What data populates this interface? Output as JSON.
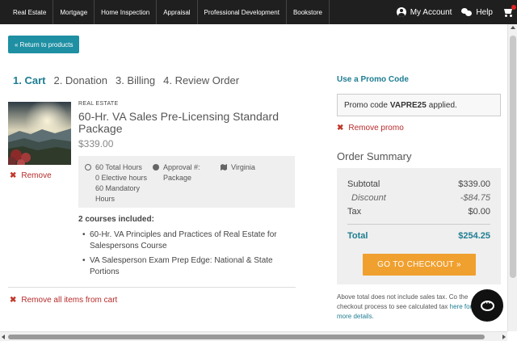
{
  "nav": {
    "items": [
      "Real Estate",
      "Mortgage",
      "Home Inspection",
      "Appraisal",
      "Professional Development",
      "Bookstore"
    ],
    "account_label": "My Account",
    "help_label": "Help",
    "icons": [
      "user-circle-icon",
      "chat-bubbles-icon",
      "shopping-cart-icon"
    ]
  },
  "back_button": "« Return to products",
  "steps": [
    "1. Cart",
    "2. Donation",
    "3. Billing",
    "4. Review Order"
  ],
  "cart": {
    "category": "REAL ESTATE",
    "title": "60-Hr. VA Sales Pre-Licensing Standard Package",
    "price": "$339.00",
    "remove_label": "Remove",
    "hours": [
      "60 Total Hours",
      "0 Elective hours",
      "60 Mandatory Hours"
    ],
    "approval": "Approval #: Package",
    "state": "Virginia",
    "courses_heading": "2 courses included:",
    "courses": [
      "60-Hr. VA Principles and Practices of Real Estate for Salespersons Course",
      "VA Salesperson Exam Prep Edge: National & State Portions"
    ],
    "remove_all_label": "Remove all items from cart"
  },
  "promo": {
    "heading": "Use a Promo Code",
    "prefix": "Promo code",
    "code": "VAPRE25",
    "suffix": "applied.",
    "remove_label": "Remove promo"
  },
  "summary": {
    "heading": "Order Summary",
    "subtotal_label": "Subtotal",
    "subtotal": "$339.00",
    "discount_label": "Discount",
    "discount": "-$84.75",
    "tax_label": "Tax",
    "tax": "$0.00",
    "total_label": "Total",
    "total": "$254.25",
    "checkout_label": "GO TO CHECKOUT »"
  },
  "note": {
    "text": "Above total does not include sales tax. Co the checkout process to see calculated tax",
    "link": "here for more details."
  },
  "colors": {
    "accent": "#1e7d92",
    "button": "#1f8fa3",
    "checkout": "#f0a02f",
    "danger": "#b72a2a",
    "nav_bg": "#1f1f1f"
  }
}
